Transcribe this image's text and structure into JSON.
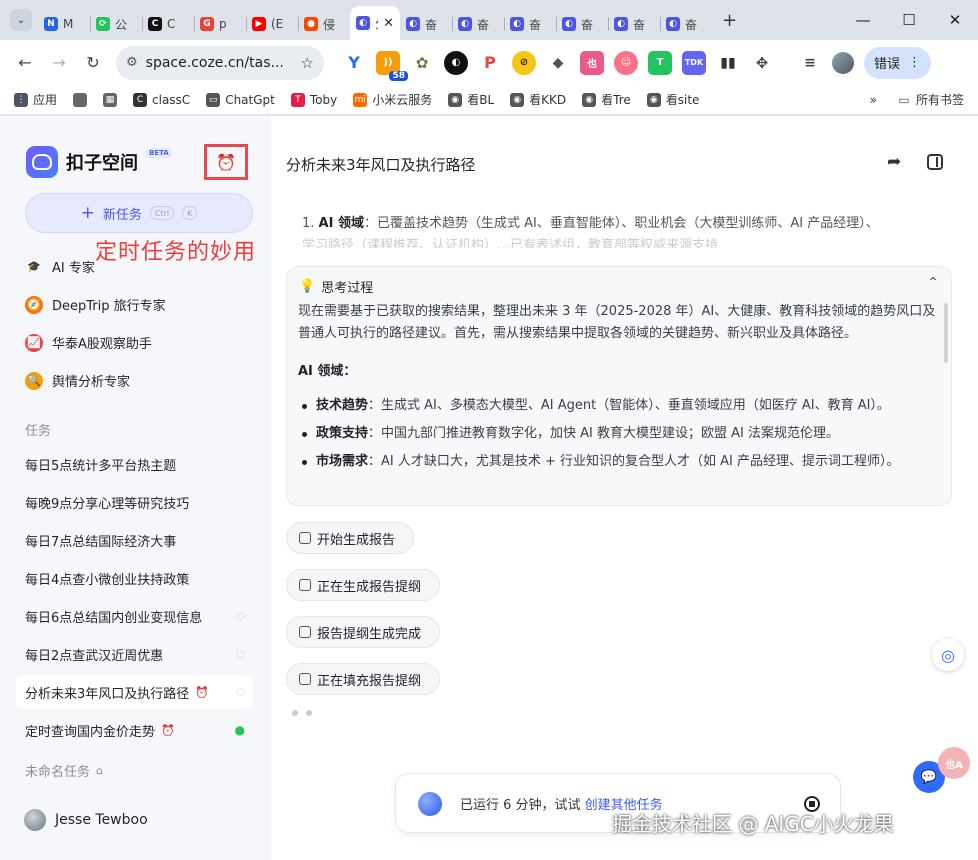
{
  "browser": {
    "tabs": [
      {
        "title": "M",
        "color": "#2563eb",
        "glyph": "N"
      },
      {
        "title": "公",
        "color": "#22c55e",
        "glyph": "⟳"
      },
      {
        "title": "C",
        "color": "#111111",
        "glyph": "C"
      },
      {
        "title": "p",
        "color": "#ea4335",
        "glyph": "G"
      },
      {
        "title": "(E",
        "color": "#ff0000",
        "glyph": "▶"
      },
      {
        "title": "侵",
        "color": "#ff4500",
        "glyph": "●"
      },
      {
        "title": "分",
        "color": "#4c55e8",
        "glyph": "◐",
        "active": true
      },
      {
        "title": "奋",
        "color": "#4c55e8",
        "glyph": "◐"
      },
      {
        "title": "奋",
        "color": "#4c55e8",
        "glyph": "◐"
      },
      {
        "title": "奋",
        "color": "#4c55e8",
        "glyph": "◐"
      },
      {
        "title": "奋",
        "color": "#4c55e8",
        "glyph": "◐"
      },
      {
        "title": "奋",
        "color": "#4c55e8",
        "glyph": "◐"
      },
      {
        "title": "奋",
        "color": "#4c55e8",
        "glyph": "◐"
      }
    ],
    "url": "space.coze.cn/tas...",
    "extension_badge": "58",
    "error_button": "错误",
    "bookmarks": [
      {
        "label": "应用",
        "color": "#4a5568",
        "glyph": "⋮"
      },
      {
        "label": "",
        "color": "#666666",
        "glyph": ""
      },
      {
        "label": "",
        "color": "#666666",
        "glyph": "▦"
      },
      {
        "label": "classC",
        "color": "#333333",
        "glyph": "C"
      },
      {
        "label": "ChatGpt",
        "color": "#555555",
        "glyph": "▭"
      },
      {
        "label": "Toby",
        "color": "#e11d48",
        "glyph": "T"
      },
      {
        "label": "小米云服务",
        "color": "#ff6900",
        "glyph": "mi"
      },
      {
        "label": "看BL",
        "color": "#555555",
        "glyph": "◉"
      },
      {
        "label": "看KKD",
        "color": "#555555",
        "glyph": "◉"
      },
      {
        "label": "看Tre",
        "color": "#555555",
        "glyph": "◉"
      },
      {
        "label": "看site",
        "color": "#555555",
        "glyph": "◉"
      }
    ],
    "bookmarks_more": "»",
    "all_bookmarks": "所有书签"
  },
  "sidebar": {
    "brand": "扣子空间",
    "beta": "BETA",
    "new_task": "新任务",
    "kbd1": "Ctrl",
    "kbd2": "K",
    "overlay": "定时任务的妙用",
    "agents": [
      {
        "label": "AI 专家",
        "glyph": "🎓",
        "bg": "transparent"
      },
      {
        "label": "DeepTrip 旅行专家",
        "glyph": "🧭",
        "bg": "#f97316"
      },
      {
        "label": "华泰A股观察助手",
        "glyph": "📈",
        "bg": "#ef4444"
      },
      {
        "label": "舆情分析专家",
        "glyph": "🔍",
        "bg": "#f59e0b"
      }
    ],
    "tasks_label": "任务",
    "tasks": [
      {
        "label": "每日5点统计多平台热主题"
      },
      {
        "label": "每晚9点分享心理等研究技巧"
      },
      {
        "label": "每日7点总结国际经济大事"
      },
      {
        "label": "每日4点查小微创业扶持政策"
      },
      {
        "label": "每日6点总结国内创业变现信息",
        "status": "◌"
      },
      {
        "label": "每日2点查武汉近周优惠",
        "status": "◌"
      },
      {
        "label": "分析未来3年风口及执行路径",
        "status": "◌",
        "clock": true,
        "active": true
      },
      {
        "label": "定时查询国内金价走势",
        "status": "●",
        "clock": true,
        "green": true
      }
    ],
    "unnamed_label": "未命名任务",
    "user": "Jesse Tewboo"
  },
  "main": {
    "title": "分析未来3年风口及执行路径",
    "summary_num": "1.",
    "summary_bold": "AI 领域",
    "summary_text": "：已覆盖技术趋势（生成式 AI、垂直智能体）、职业机会（大模型训练师、AI 产品经理）、",
    "summary_faded": "学习路径（课程推荐、认证机构）…已有表述组，教育部等权威来源支持",
    "think": {
      "label": "思考过程",
      "intro": "现在需要基于已获取的搜索结果，整理出未来 3 年（2025-2028 年）AI、大健康、教育科技领域的趋势风口及普通人可执行的路径建议。首先，需从搜索结果中提取各领域的关键趋势、新兴职业及具体路径。",
      "section": "AI 领域：",
      "items": [
        {
          "bold": "技术趋势",
          "text": "：生成式 AI、多模态大模型、AI Agent（智能体）、垂直领域应用（如医疗 AI、教育 AI）。"
        },
        {
          "bold": "政策支持",
          "text": "：中国九部门推进教育数字化，加快 AI 教育大模型建设；欧盟 AI 法案规范伦理。"
        },
        {
          "bold": "市场需求",
          "text": "：AI 人才缺口大，尤其是技术 + 行业知识的复合型人才（如 AI 产品经理、提示词工程师）。"
        }
      ]
    },
    "steps": [
      "开始生成报告",
      "正在生成报告提纲",
      "报告提纲生成完成",
      "正在填充报告提纲"
    ],
    "status_text": "已运行 6 分钟，试试 ",
    "status_link": "创建其他任务",
    "float_c": "也A"
  },
  "watermark": "掘金技术社区 @ AIGC小火龙果"
}
